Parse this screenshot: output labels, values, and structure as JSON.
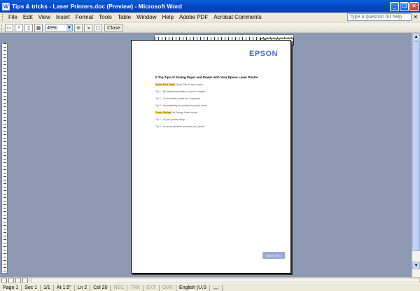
{
  "window": {
    "title": "Tips & tricks - Laser Printers.doc (Preview) - Microsoft Word",
    "app_icon": "W"
  },
  "menu": {
    "items": [
      "File",
      "Edit",
      "View",
      "Insert",
      "Format",
      "Tools",
      "Table",
      "Window",
      "Help",
      "Adobe PDF",
      "Acrobat Comments"
    ],
    "help_placeholder": "Type a question for help",
    "close_glyph": "✕"
  },
  "toolbar": {
    "zoom": "49%",
    "close_label": "Close"
  },
  "ruler": {
    "tooltip": "Right Margin"
  },
  "document": {
    "logo": "EPSON",
    "heading": "5 Top Tips of Saving Paper and Power with Your Epson Laser Printer",
    "paragraphs": [
      {
        "highlight": "Epson Print Driver",
        "text": " Quick Tips to save paper..."
      },
      {
        "highlight": "",
        "text": "Tip 1 - By default set printers to print in duplex..."
      },
      {
        "highlight": "",
        "text": "Tip 2 - Conveniently locate two recipients..."
      },
      {
        "highlight": "",
        "text": "Tip 3 - Automatically set printers to power down..."
      },
      {
        "highlight": "Power Saving",
        "text": " Set Energy Saver mode..."
      },
      {
        "highlight": "",
        "text": "Tip 4 - In your printer setup..."
      },
      {
        "highlight": "",
        "text": "Tip 5 - As far as possible, preview your prints..."
      }
    ],
    "footer": "Epson TIPS"
  },
  "status": {
    "page": "Page 1",
    "sec": "Sec 1",
    "pages": "1/1",
    "at": "At 1.5\"",
    "ln": "Ln 2",
    "col": "Col 20",
    "rec": "REC",
    "trk": "TRK",
    "ext": "EXT",
    "ovr": "OVR",
    "lang": "English (U.S"
  }
}
